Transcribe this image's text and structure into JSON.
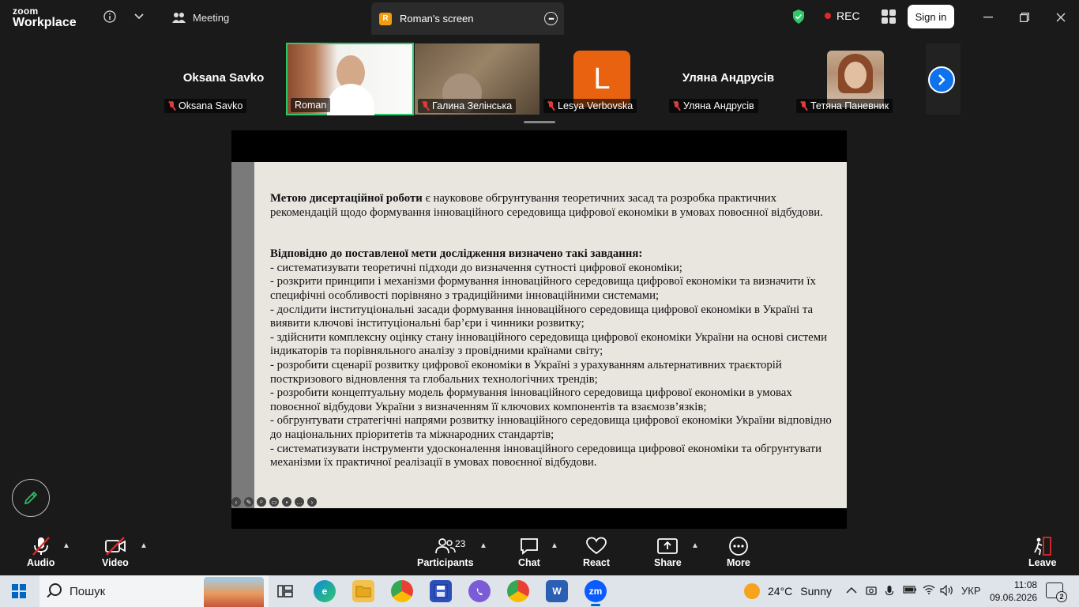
{
  "window": {
    "logo_line1": "zoom",
    "logo_line2": "Workplace",
    "meeting_tab": "Meeting",
    "screen_tab": "Roman's screen",
    "screen_tab_badge": "R",
    "rec_label": "REC",
    "sign_in": "Sign in"
  },
  "gallery": {
    "participants": [
      {
        "display": "Oksana Savko",
        "label": "Oksana Savko",
        "type": "name"
      },
      {
        "display": "",
        "label": "Roman",
        "type": "video"
      },
      {
        "display": "",
        "label": "Галина Зелінська",
        "type": "video"
      },
      {
        "display": "L",
        "label": "Lesya Verbovska",
        "type": "avatar"
      },
      {
        "display": "Уляна Андрусів",
        "label": "Уляна Андрусів",
        "type": "name"
      },
      {
        "display": "",
        "label": "Тетяна Паневник",
        "type": "photo"
      }
    ]
  },
  "slide": {
    "para1_bold": "Метою дисертаційної роботи",
    "para1_rest": " є науковове обгрунтування теоретичних засад та розробка практичних рекомендацій щодо формування інноваційного середовища цифрової економіки в умовах повоєнної відбудови.",
    "tasks_heading": "Відповідно до поставленої мети дослідження визначено такі завдання:",
    "tasks": [
      "- систематизувати теоретичні підходи до визначення сутності цифрової економіки;",
      "- розкрити принципи і механізми формування інноваційного середовища цифрової економіки та визначити їх специфічні особливості порівняно з традиційними інноваційними системами;",
      "- дослідити інституціональні засади формування інноваційного середовища цифрової економіки в Україні та виявити ключові інституціональні бар’єри і чинники розвитку;",
      "- здійснити комплексну оцінку стану інноваційного середовища цифрової економіки України на основі системи індикаторів та порівняльного аналізу з провідними країнами світу;",
      "- розробити сценарії розвитку цифрової економіки в Україні з урахуванням альтернативних траєкторій посткризового відновлення та глобальних технологічних трендів;",
      "- розробити концептуальну модель формування інноваційного середовища цифрової економіки в умовах повоєнної відбудови України з визначенням її ключових компонентів та взаємозв’язків;",
      "- обгрунтувати стратегічні напрями розвитку інноваційного середовища цифрової економіки України відповідно до національних пріоритетів та міжнародних стандартів;",
      "- систематизувати інструменти удосконалення інноваційного середовища цифрової економіки та обгрунтувати механізми їх практичної реалізації в умовах повоєнної відбудови."
    ]
  },
  "toolbar": {
    "audio": "Audio",
    "video": "Video",
    "participants": "Participants",
    "participants_count": "23",
    "chat": "Chat",
    "react": "React",
    "share": "Share",
    "more": "More",
    "leave": "Leave"
  },
  "taskbar": {
    "search_placeholder": "Пошук",
    "weather_temp": "24°C",
    "weather_desc": "Sunny",
    "lang": "УКР",
    "time": "11:08",
    "date": "09.06.2026",
    "notifications": "2"
  },
  "colors": {
    "accent_green": "#2ec76a",
    "rec_red": "#e02828",
    "zoom_blue": "#0e72ed",
    "avatar_orange": "#e8620f"
  }
}
